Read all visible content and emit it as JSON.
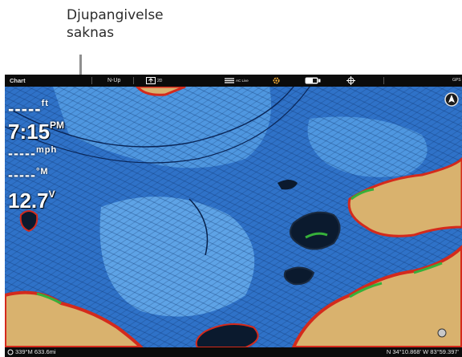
{
  "callout": {
    "line1": "Djupangivelse",
    "line2": "saknas"
  },
  "topbar": {
    "title": "Chart",
    "orientation": "N-Up",
    "zoom_badge": "2D",
    "autochart_label": "AC Live",
    "gps_label": "GPS"
  },
  "hud": {
    "depth": "-----",
    "depth_unit": "ft",
    "time": "7:15",
    "time_suffix": "PM",
    "speed": "-----",
    "speed_unit": "mph",
    "temp": "-----",
    "temp_unit": "°M",
    "voltage": "12.7",
    "voltage_unit": "V"
  },
  "bottombar": {
    "heading_distance": "339°M  633.6mi",
    "position": "N 34°10.868' W 83°59.397'"
  },
  "colors": {
    "water_deep": "#2f72c8",
    "water_mid": "#4f97e0",
    "water_shallow": "#8cc2f0",
    "land": "#d9b26e",
    "shore_red": "#d42a1c",
    "shore_green": "#36b03a"
  },
  "icons": [
    "settings-icon",
    "battery-icon",
    "crosshair-icon",
    "north-compass-icon",
    "waypoint-icon"
  ]
}
